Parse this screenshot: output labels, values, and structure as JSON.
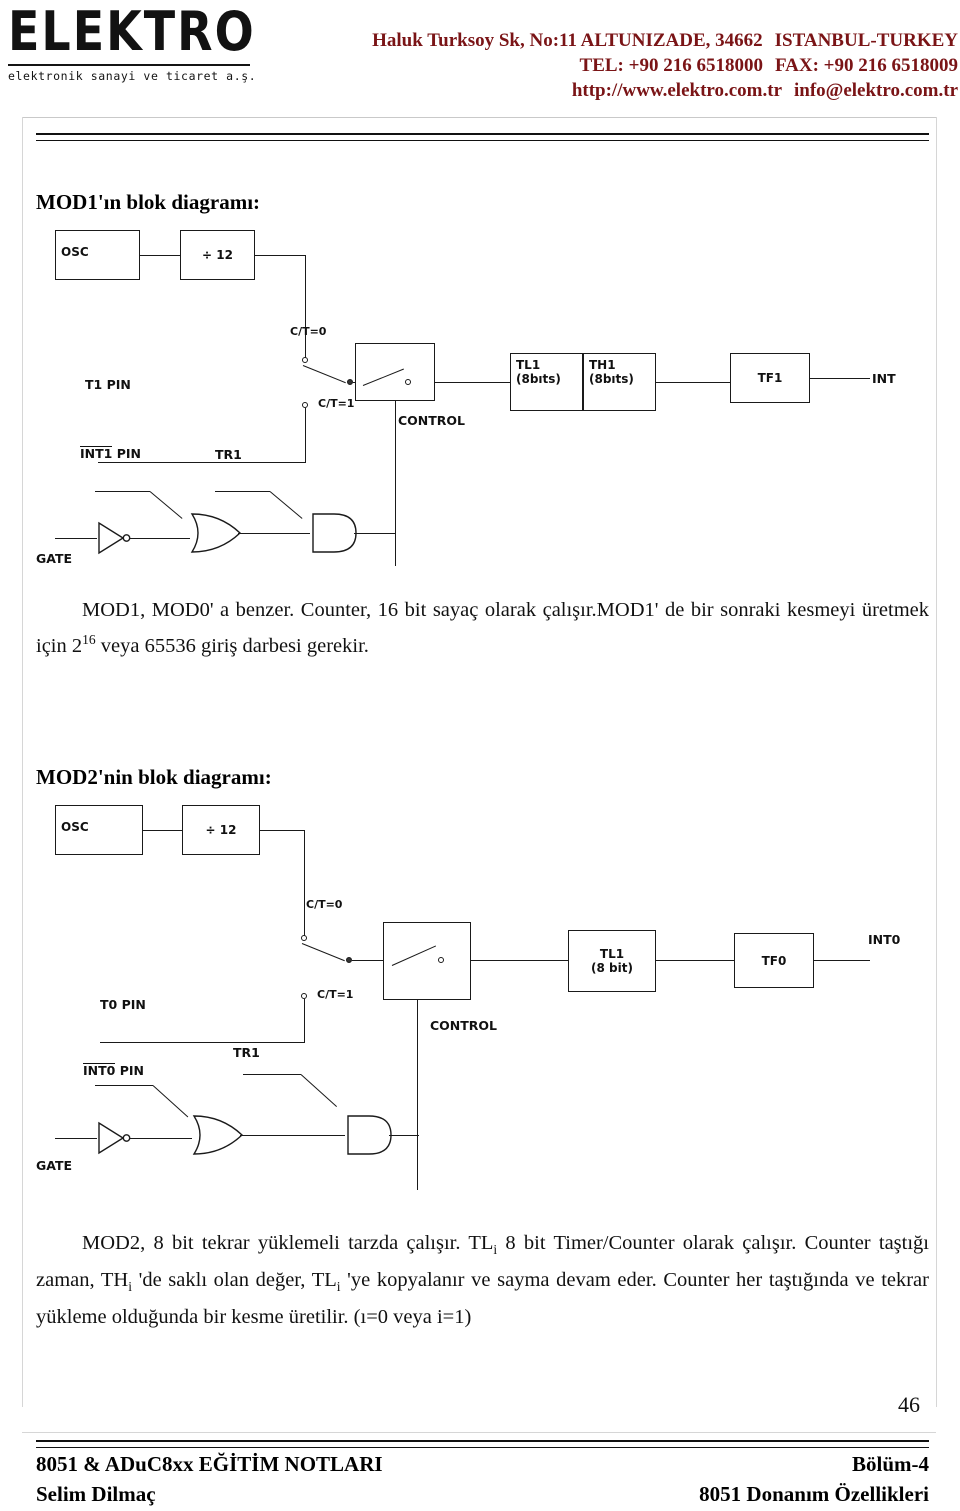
{
  "header": {
    "logo_word": "ELEKTRO",
    "logo_tagline": "elektronik sanayi ve ticaret a.ş.",
    "address_line1": "Haluk Turksoy Sk, No:11 ALTUNIZADE, 34662",
    "address_line1b": "ISTANBUL-TURKEY",
    "tel": "TEL: +90 216 6518000",
    "fax": "FAX: +90 216 6518009",
    "website": "http://www.elektro.com.tr",
    "email": "info@elektro.com.tr",
    "accent_color": "#7a1416"
  },
  "sections": [
    {
      "heading": "MOD1'ın blok diagramı:",
      "diagram": {
        "name": "mod1-block-diagram",
        "boxes": [
          {
            "label": "OSC"
          },
          {
            "label": "÷ 12"
          },
          {
            "label": "CONTROL"
          },
          {
            "label_line1": "TL1",
            "label_line2": "(8bıts)"
          },
          {
            "label_line1": "TH1",
            "label_line2": "(8bıts)"
          },
          {
            "label": "TF1"
          }
        ],
        "labels": [
          "C/T=0",
          "C/T=1",
          "T1 PIN",
          "INT1 PIN",
          "TR1",
          "GATE",
          "CONTROL",
          "INT"
        ]
      },
      "paragraph_pre": "MOD1, MOD0' a benzer. Counter, 16 bit sayaç olarak çalışır.MOD1' de bir sonraki kesmeyi üretmek için 2",
      "paragraph_sup": "16",
      "paragraph_post": " veya 65536 giriş darbesi gerekir."
    },
    {
      "heading": "MOD2'nin blok diagramı:",
      "diagram": {
        "name": "mod2-block-diagram",
        "boxes": [
          {
            "label": "OSC"
          },
          {
            "label": "÷ 12"
          },
          {
            "label": "CONTROL"
          },
          {
            "label_line1": "TL1",
            "label_line2": "(8 bit)"
          },
          {
            "label": "TF0"
          }
        ],
        "labels": [
          "C/T=0",
          "C/T=1",
          "T0 PIN",
          "INT0 PIN",
          "TR1",
          "GATE",
          "CONTROL",
          "INT0"
        ]
      }
    }
  ],
  "diagram1": {
    "osc": "OSC",
    "div12": "÷ 12",
    "ct0": "C/T=0",
    "ct1": "C/T=1",
    "t_pin": "T1 PIN",
    "int_pin_bar": "INT1",
    "int_pin_rest": " PIN",
    "tr1": "TR1",
    "gate": "GATE",
    "control": "CONTROL",
    "tl_line1": "TL1",
    "tl_line2": "(8bıts)",
    "th_line1": "TH1",
    "th_line2": "(8bıts)",
    "tf": "TF1",
    "int_out": "INT"
  },
  "diagram2": {
    "osc": "OSC",
    "div12": "÷ 12",
    "ct0": "C/T=0",
    "ct1": "C/T=1",
    "t_pin": "T0 PIN",
    "int_pin_bar": "INT0",
    "int_pin_rest": " PIN",
    "tr1": "TR1",
    "gate": "GATE",
    "control": "CONTROL",
    "tl_line1": "TL1",
    "tl_line2": "(8 bit)",
    "tf": "TF0",
    "int_out": "INT0"
  },
  "paragraph1": {
    "pre": "MOD1, MOD0' a benzer. Counter, 16 bit sayaç olarak çalışır.MOD1' de bir sonraki kesmeyi üretmek için 2",
    "sup": "16",
    "post": " veya 65536 giriş darbesi gerekir."
  },
  "paragraph2": {
    "l1a": "MOD2, 8 bit tekrar yüklemeli tarzda çalışır. TL",
    "l1sub": "i",
    "l1b": " 8 bit Timer/Counter olarak çalışır. Counter taştığı zaman, TH",
    "l2sub": "i",
    "l2b": " 'de saklı olan değer, TL",
    "l3sub": "i",
    "l3b": " 'ye kopyalanır ve sayma devam eder. Counter her taştığında ve tekrar yükleme olduğunda bir kesme üretilir. (ı=0 veya i=1)"
  },
  "footer": {
    "page_number": "46",
    "left_line1": "8051 & ADuC8xx EĞİTİM NOTLARI",
    "left_line2": "Selim Dilmaç",
    "right_line1": "Bölüm-4",
    "right_line2": "8051 Donanım Özellikleri"
  }
}
